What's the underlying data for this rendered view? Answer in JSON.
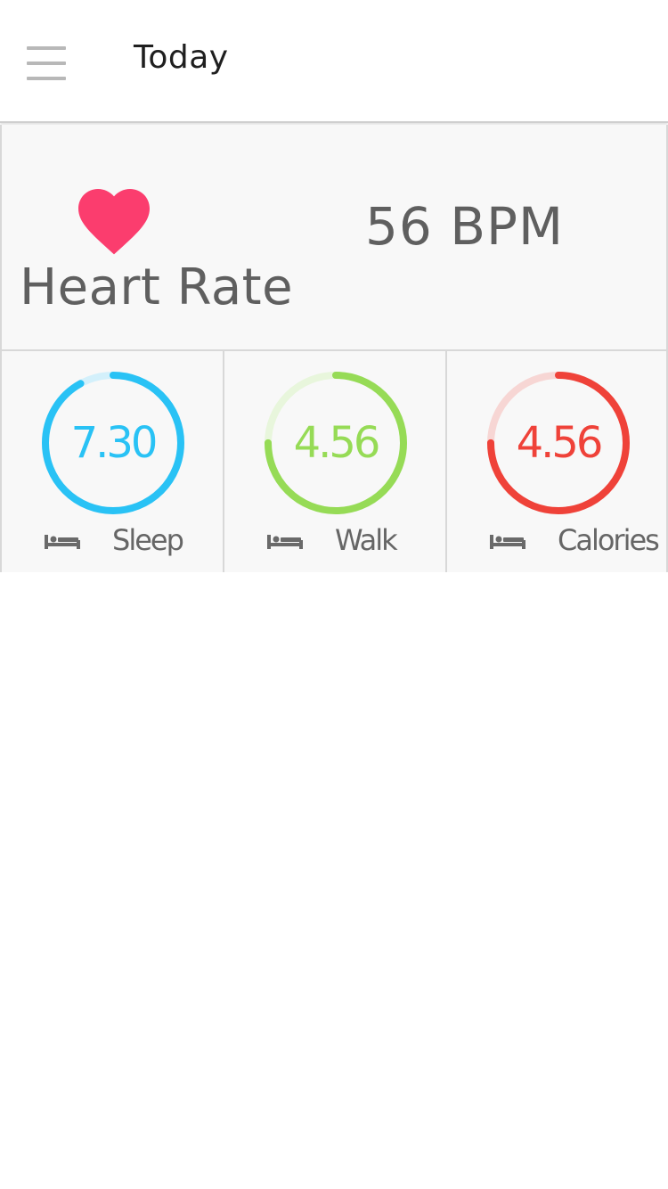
{
  "header": {
    "title": "Today",
    "menu_icon": "hamburger-menu-icon"
  },
  "heart_rate": {
    "label": "Heart Rate",
    "value": "56 BPM",
    "icon": "heart-icon",
    "color": "#fb3d6e"
  },
  "stats": [
    {
      "value": "7.30",
      "label": "Sleep",
      "icon": "bed-icon",
      "color": "#29c2f5",
      "track_color": "#d3f0fb",
      "progress": 0.92
    },
    {
      "value": "4.56",
      "label": "Walk",
      "icon": "bed-icon",
      "color": "#96db56",
      "track_color": "#e8f6dc",
      "progress": 0.75
    },
    {
      "value": "4.56",
      "label": "Calories",
      "icon": "bed-icon",
      "color": "#ef4239",
      "track_color": "#f7d6d4",
      "progress": 0.75
    }
  ]
}
